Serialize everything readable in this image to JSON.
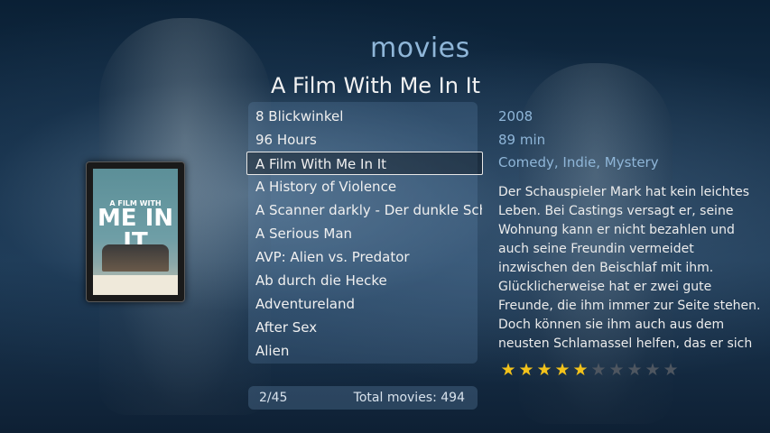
{
  "header": {
    "section": "movies",
    "title": "A Film With Me In It"
  },
  "movie_list": {
    "items": [
      "8 Blickwinkel",
      "96 Hours",
      "A Film With Me In It",
      "A History of Violence",
      "A Scanner darkly - Der dunkle Schein",
      "A Serious Man",
      "AVP: Alien vs. Predator",
      "Ab durch die Hecke",
      "Adventureland",
      "After Sex",
      "Alien"
    ],
    "selected_index": 2
  },
  "footer": {
    "position": "2/45",
    "total": "Total movies: 494"
  },
  "details": {
    "year": "2008",
    "runtime": "89 min",
    "genres": "Comedy, Indie, Mystery",
    "plot": "Der Schauspieler Mark hat kein leichtes Leben. Bei Castings versagt er, seine Wohnung kann er nicht bezahlen und auch seine Freundin vermeidet inzwischen den Beischlaf mit ihm. Glücklicherweise hat er zwei gute Freunde, die ihm immer zur Seite stehen. Doch können sie ihm auch aus dem neusten Schlamassel helfen, das er sich zufälligerweise eingebrockt hat?",
    "rating": 5,
    "rating_max": 10
  },
  "poster": {
    "title_small": "A FILM WITH",
    "title_big": "ME IN IT"
  },
  "colors": {
    "accent": "#8fb6d8",
    "star_on": "#f2c21b",
    "star_off": "#4e5660"
  }
}
